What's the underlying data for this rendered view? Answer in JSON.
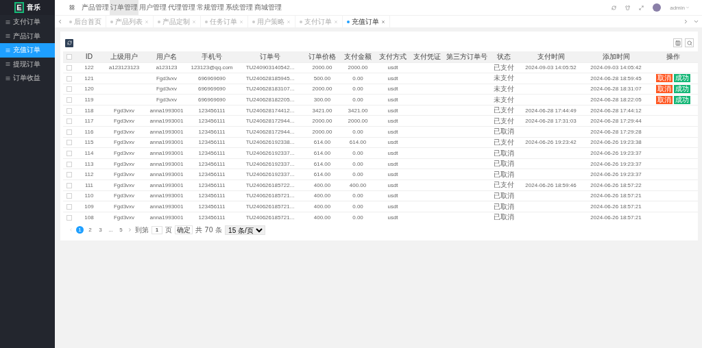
{
  "logo": {
    "mark": "E",
    "title": "音乐"
  },
  "sidebar": {
    "items": [
      {
        "label": "支付订单",
        "selected": false
      },
      {
        "label": "产品订单",
        "selected": false
      },
      {
        "label": "充值订单",
        "selected": true
      },
      {
        "label": "提现订单",
        "selected": false
      },
      {
        "label": "订单收益",
        "selected": false
      }
    ]
  },
  "top_nav": {
    "items": [
      {
        "label": "产品管理",
        "selected": false
      },
      {
        "label": "订单管理",
        "selected": true
      },
      {
        "label": "用户管理",
        "selected": false
      },
      {
        "label": "代理管理",
        "selected": false
      },
      {
        "label": "常规管理",
        "selected": false
      },
      {
        "label": "系统管理",
        "selected": false
      },
      {
        "label": "商城管理",
        "selected": false
      }
    ],
    "user": "admin"
  },
  "tabs": [
    {
      "label": "后台首页",
      "selected": false,
      "closable": false
    },
    {
      "label": "产品列表",
      "selected": false,
      "closable": true
    },
    {
      "label": "产品定制",
      "selected": false,
      "closable": true
    },
    {
      "label": "任务订单",
      "selected": false,
      "closable": true
    },
    {
      "label": "用户策略",
      "selected": false,
      "closable": true
    },
    {
      "label": "支付订单",
      "selected": false,
      "closable": true
    },
    {
      "label": "充值订单",
      "selected": true,
      "closable": true
    }
  ],
  "table": {
    "header_checked": false,
    "columns": [
      "ID",
      "上级用户",
      "用户名",
      "手机号",
      "订单号",
      "订单价格",
      "支付金额",
      "支付方式",
      "支付凭证",
      "第三方订单号",
      "状态",
      "支付时间",
      "添加时间",
      "操作"
    ],
    "rows": [
      {
        "checked": false,
        "cells": [
          "122",
          "a123123123",
          "a123123",
          "123123@qq.com",
          "TU240903140542...",
          "2000.00",
          "2000.00",
          "usdt",
          "",
          "",
          "已支付",
          "2024-09-03 14:05:52",
          "2024-09-03 14:05:42"
        ],
        "actions": []
      },
      {
        "checked": false,
        "cells": [
          "121",
          "",
          "Fgd3vxv",
          "696969690",
          "TU240628185945...",
          "500.00",
          "0.00",
          "usdt",
          "",
          "",
          "未支付",
          "",
          "2024-06-28 18:59:45"
        ],
        "actions": [
          {
            "label": "取消",
            "kind": "danger"
          },
          {
            "label": "成功",
            "kind": "success"
          }
        ]
      },
      {
        "checked": false,
        "cells": [
          "120",
          "",
          "Fgd3vxv",
          "696969690",
          "TU240628183107...",
          "2000.00",
          "0.00",
          "usdt",
          "",
          "",
          "未支付",
          "",
          "2024-06-28 18:31:07"
        ],
        "actions": [
          {
            "label": "取消",
            "kind": "danger"
          },
          {
            "label": "成功",
            "kind": "success"
          }
        ]
      },
      {
        "checked": false,
        "cells": [
          "119",
          "",
          "Fgd3vxv",
          "696969690",
          "TU240628182205...",
          "300.00",
          "0.00",
          "usdt",
          "",
          "",
          "未支付",
          "",
          "2024-06-28 18:22:05"
        ],
        "actions": [
          {
            "label": "取消",
            "kind": "danger"
          },
          {
            "label": "成功",
            "kind": "success"
          }
        ]
      },
      {
        "checked": false,
        "cells": [
          "118",
          "Fgd3vxv",
          "anna1993001",
          "123456111",
          "TU240628174412...",
          "3421.00",
          "3421.00",
          "usdt",
          "",
          "",
          "已支付",
          "2024-06-28 17:44:49",
          "2024-06-28 17:44:12"
        ],
        "actions": []
      },
      {
        "checked": false,
        "cells": [
          "117",
          "Fgd3vxv",
          "anna1993001",
          "123456111",
          "TU240628172944...",
          "2000.00",
          "2000.00",
          "usdt",
          "",
          "",
          "已支付",
          "2024-06-28 17:31:03",
          "2024-06-28 17:29:44"
        ],
        "actions": []
      },
      {
        "checked": false,
        "cells": [
          "116",
          "Fgd3vxv",
          "anna1993001",
          "123456111",
          "TU240628172944...",
          "2000.00",
          "0.00",
          "usdt",
          "",
          "",
          "已取消",
          "",
          "2024-06-28 17:29:28"
        ],
        "actions": []
      },
      {
        "checked": false,
        "cells": [
          "115",
          "Fgd3vxv",
          "anna1993001",
          "123456111",
          "TU240626192338...",
          "614.00",
          "614.00",
          "usdt",
          "",
          "",
          "已支付",
          "2024-06-26 19:23:42",
          "2024-06-26 19:23:38"
        ],
        "actions": []
      },
      {
        "checked": false,
        "cells": [
          "114",
          "Fgd3vxv",
          "anna1993001",
          "123456111",
          "TU240626192337...",
          "614.00",
          "0.00",
          "usdt",
          "",
          "",
          "已取消",
          "",
          "2024-06-26 19:23:37"
        ],
        "actions": []
      },
      {
        "checked": false,
        "cells": [
          "113",
          "Fgd3vxv",
          "anna1993001",
          "123456111",
          "TU240626192337...",
          "614.00",
          "0.00",
          "usdt",
          "",
          "",
          "已取消",
          "",
          "2024-06-26 19:23:37"
        ],
        "actions": []
      },
      {
        "checked": false,
        "cells": [
          "112",
          "Fgd3vxv",
          "anna1993001",
          "123456111",
          "TU240626192337...",
          "614.00",
          "0.00",
          "usdt",
          "",
          "",
          "已取消",
          "",
          "2024-06-26 19:23:37"
        ],
        "actions": []
      },
      {
        "checked": false,
        "cells": [
          "111",
          "Fgd3vxv",
          "anna1993001",
          "123456111",
          "TU240626185722...",
          "400.00",
          "400.00",
          "usdt",
          "",
          "",
          "已支付",
          "2024-06-26 18:59:46",
          "2024-06-26 18:57:22"
        ],
        "actions": []
      },
      {
        "checked": false,
        "cells": [
          "110",
          "Fgd3vxv",
          "anna1993001",
          "123456111",
          "TU240626185721...",
          "400.00",
          "0.00",
          "usdt",
          "",
          "",
          "已取消",
          "",
          "2024-06-26 18:57:21"
        ],
        "actions": []
      },
      {
        "checked": false,
        "cells": [
          "109",
          "Fgd3vxv",
          "anna1993001",
          "123456111",
          "TU240626185721...",
          "400.00",
          "0.00",
          "usdt",
          "",
          "",
          "已取消",
          "",
          "2024-06-26 18:57:21"
        ],
        "actions": []
      },
      {
        "checked": false,
        "cells": [
          "108",
          "Fgd3vxv",
          "anna1993001",
          "123456111",
          "TU240626185721...",
          "400.00",
          "0.00",
          "usdt",
          "",
          "",
          "已取消",
          "",
          "2024-06-26 18:57:21"
        ],
        "actions": []
      }
    ]
  },
  "pagination": {
    "pages": [
      {
        "label": "1",
        "selected": true
      },
      {
        "label": "2",
        "selected": false
      },
      {
        "label": "3",
        "selected": false
      },
      {
        "label": "...",
        "selected": false
      },
      {
        "label": "5",
        "selected": false
      }
    ],
    "goto_label": "到第",
    "goto_value": "1",
    "page_unit": "页",
    "confirm": "确定",
    "total": "共 70 条",
    "page_size": "15 条/页"
  }
}
